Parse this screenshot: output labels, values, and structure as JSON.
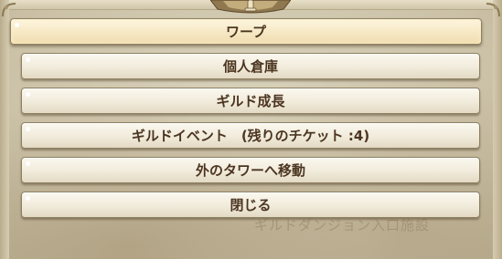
{
  "menu": {
    "items": [
      {
        "label": "ワープ"
      },
      {
        "label": "個人倉庫"
      },
      {
        "label": "ギルド成長"
      },
      {
        "label": "ギルドイベント　(残りのチケット :4)"
      },
      {
        "label": "外のタワーへ移動"
      },
      {
        "label": "閉じる"
      }
    ]
  },
  "background": {
    "watermark_text": "ギルドダンジョン入口施設"
  },
  "colors": {
    "text": "#4b3520",
    "button_face": "#f1ebdb",
    "highlight_face": "#f7e9c6",
    "panel": "#cbc2a8"
  }
}
